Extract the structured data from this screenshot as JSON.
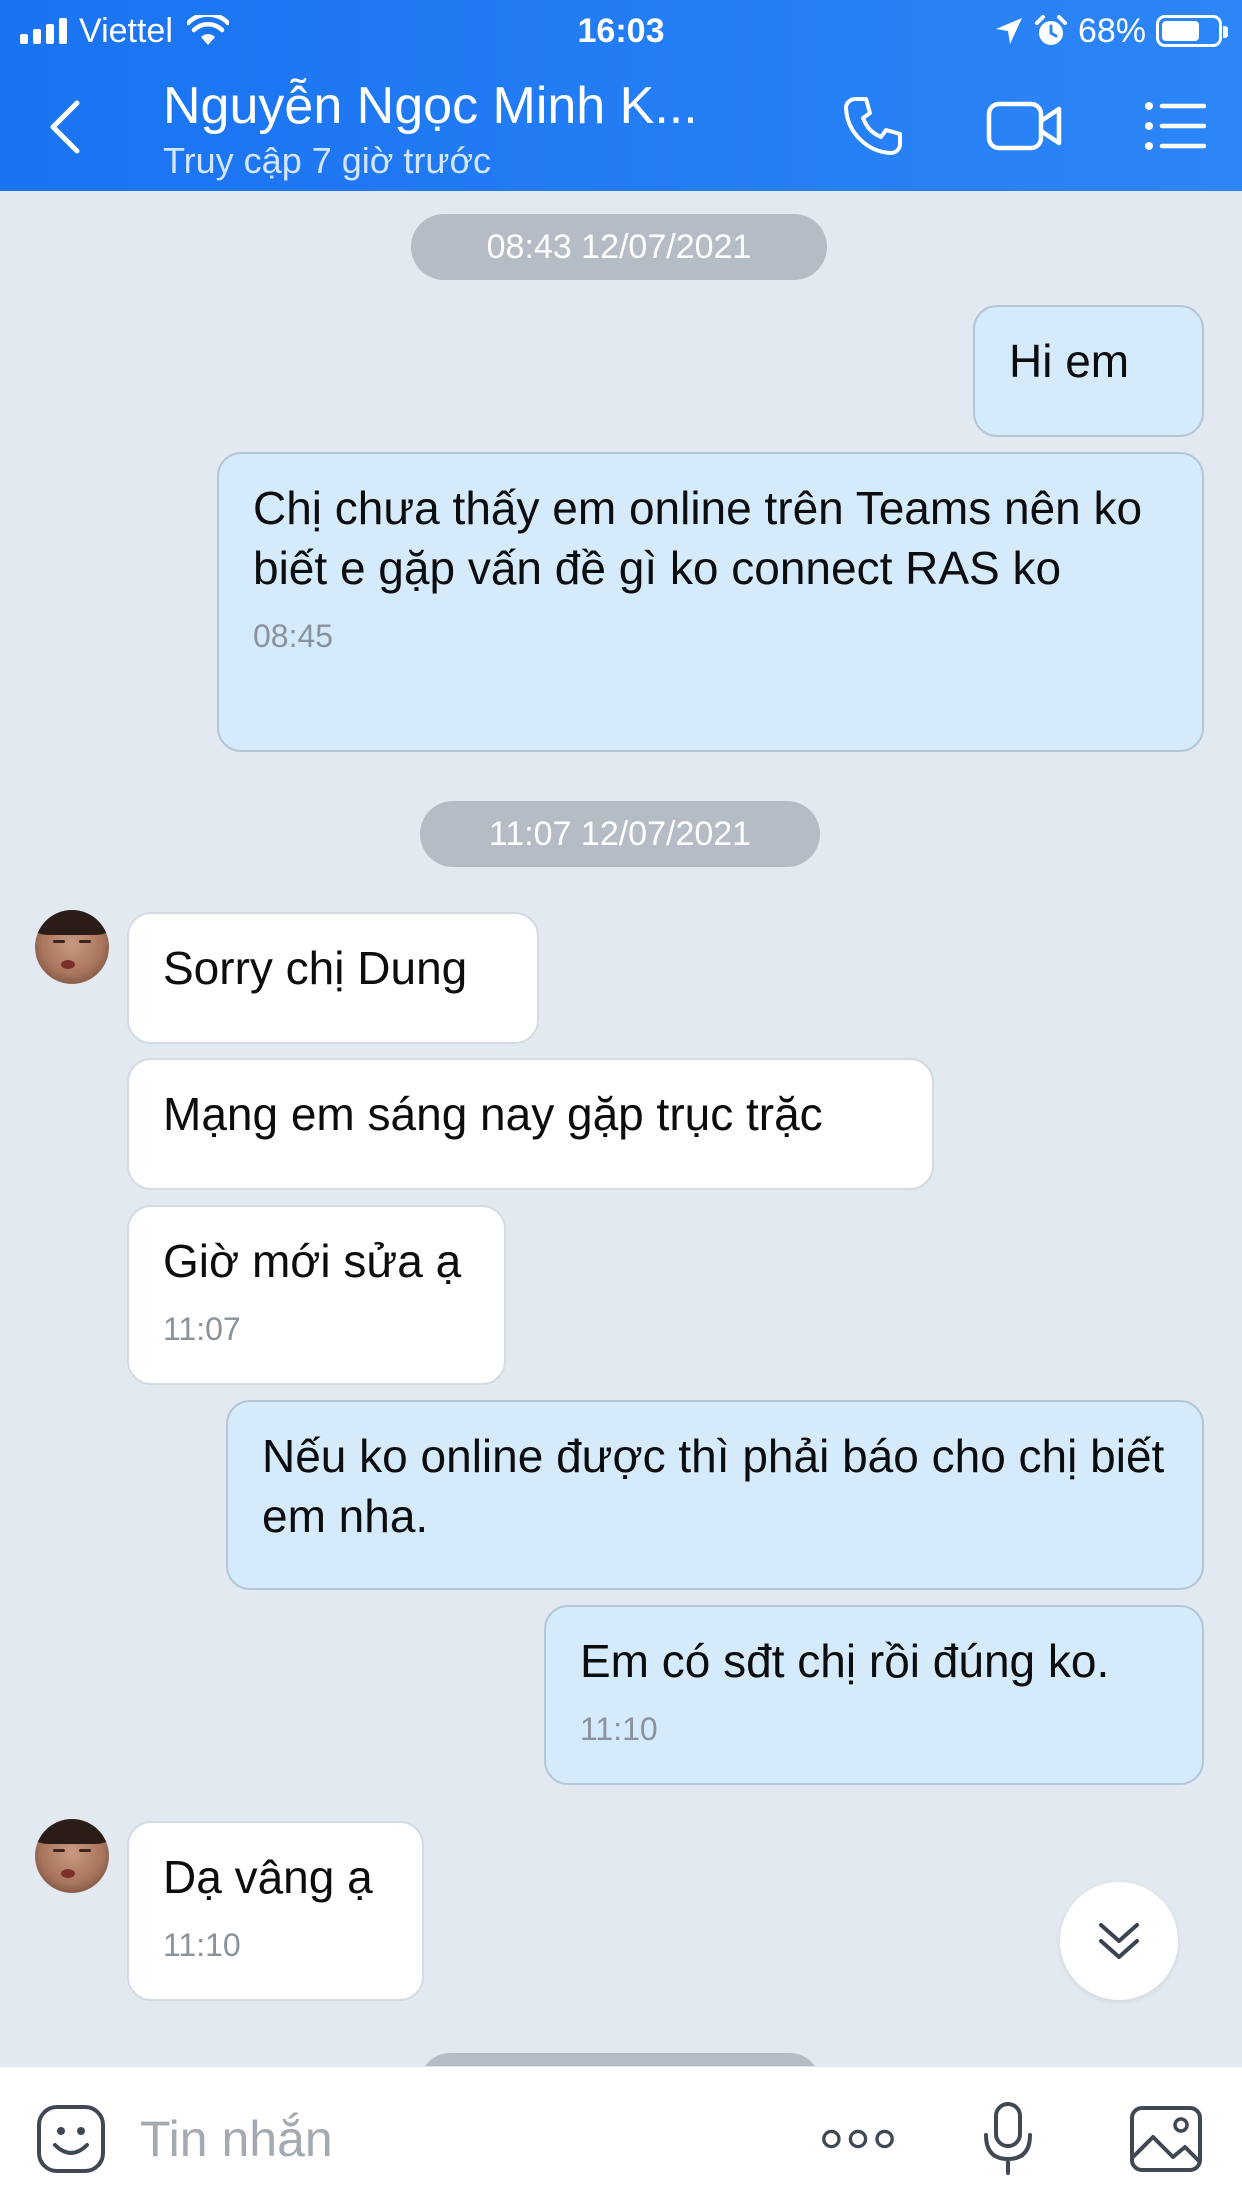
{
  "status_bar": {
    "carrier": "Viettel",
    "time": "16:03",
    "battery": "68%",
    "battery_level": 0.68,
    "icons": [
      "signal-icon",
      "wifi-icon",
      "location-icon",
      "alarm-icon",
      "battery-icon"
    ]
  },
  "header": {
    "title": "Nguyễn Ngọc Minh K...",
    "subtitle": "Truy cập 7 giờ trước",
    "icons": [
      "back-icon",
      "phone-icon",
      "video-call-icon",
      "menu-list-icon"
    ]
  },
  "timestamps": [
    "08:43 12/07/2021",
    "11:07 12/07/2021"
  ],
  "messages": [
    {
      "text": "Hi em",
      "time": ""
    },
    {
      "text": "Chị chưa thấy em online trên Teams nên ko biết e gặp vấn đề gì ko connect RAS ko",
      "time": "08:45"
    },
    {
      "text": "Sorry chị Dung",
      "time": ""
    },
    {
      "text": "Mạng em sáng nay gặp trục trặc",
      "time": ""
    },
    {
      "text": "Giờ mới sửa ạ",
      "time": "11:07"
    },
    {
      "text": "Nếu ko online được thì phải báo cho chị biết em nha.",
      "time": ""
    },
    {
      "text": "Em có sđt chị rồi đúng ko.",
      "time": "11:10"
    },
    {
      "text": "Dạ vâng ạ",
      "time": "11:10"
    }
  ],
  "input": {
    "placeholder": "Tin nhắn",
    "icons": [
      "emoji-icon",
      "more-icon",
      "microphone-icon",
      "image-icon"
    ]
  },
  "colors": {
    "header_blue": "#1a73f0",
    "outgoing_bubble": "#d5ebfb",
    "incoming_bubble": "#ffffff",
    "chat_background": "#e2e9f1",
    "timestamp_pill": "#b5bcc5"
  }
}
